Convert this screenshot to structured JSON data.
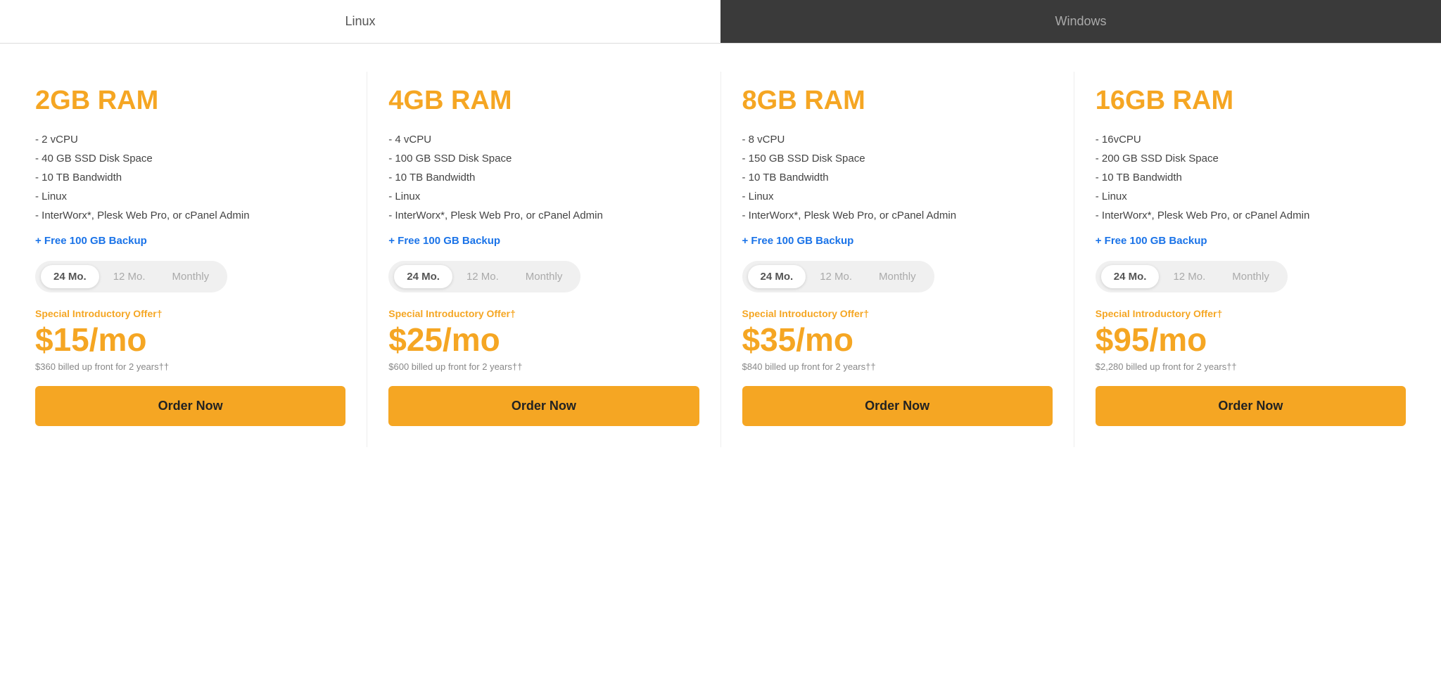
{
  "tabs": [
    {
      "id": "linux",
      "label": "Linux",
      "active": true
    },
    {
      "id": "windows",
      "label": "Windows",
      "active": false
    }
  ],
  "plans": [
    {
      "id": "2gb",
      "title": "2GB RAM",
      "features": [
        "- 2 vCPU",
        "- 40 GB SSD Disk Space",
        "- 10 TB Bandwidth",
        "- Linux",
        "- InterWorx*, Plesk Web Pro, or cPanel Admin"
      ],
      "backup": "+ Free 100 GB Backup",
      "toggle": {
        "options": [
          {
            "label": "24 Mo.",
            "selected": true
          },
          {
            "label": "12 Mo.",
            "selected": false
          },
          {
            "label": "Monthly",
            "selected": false
          }
        ]
      },
      "intro_label": "Special Introductory Offer†",
      "price": "$15/mo",
      "billed": "$360 billed up front for 2 years††",
      "order_label": "Order Now"
    },
    {
      "id": "4gb",
      "title": "4GB RAM",
      "features": [
        "- 4 vCPU",
        "- 100 GB SSD Disk Space",
        "- 10 TB Bandwidth",
        "- Linux",
        "- InterWorx*, Plesk Web Pro, or cPanel Admin"
      ],
      "backup": "+ Free 100 GB Backup",
      "toggle": {
        "options": [
          {
            "label": "24 Mo.",
            "selected": true
          },
          {
            "label": "12 Mo.",
            "selected": false
          },
          {
            "label": "Monthly",
            "selected": false
          }
        ]
      },
      "intro_label": "Special Introductory Offer†",
      "price": "$25/mo",
      "billed": "$600 billed up front for 2 years††",
      "order_label": "Order Now"
    },
    {
      "id": "8gb",
      "title": "8GB RAM",
      "features": [
        "- 8 vCPU",
        "- 150 GB SSD Disk Space",
        "- 10 TB Bandwidth",
        "- Linux",
        "- InterWorx*, Plesk Web Pro, or cPanel Admin"
      ],
      "backup": "+ Free 100 GB Backup",
      "toggle": {
        "options": [
          {
            "label": "24 Mo.",
            "selected": true
          },
          {
            "label": "12 Mo.",
            "selected": false
          },
          {
            "label": "Monthly",
            "selected": false
          }
        ]
      },
      "intro_label": "Special Introductory Offer†",
      "price": "$35/mo",
      "billed": "$840 billed up front for 2 years††",
      "order_label": "Order Now"
    },
    {
      "id": "16gb",
      "title": "16GB RAM",
      "features": [
        "- 16vCPU",
        "- 200 GB SSD Disk Space",
        "- 10 TB Bandwidth",
        "- Linux",
        "- InterWorx*, Plesk Web Pro, or cPanel Admin"
      ],
      "backup": "+ Free 100 GB Backup",
      "toggle": {
        "options": [
          {
            "label": "24 Mo.",
            "selected": true
          },
          {
            "label": "12 Mo.",
            "selected": false
          },
          {
            "label": "Monthly",
            "selected": false
          }
        ]
      },
      "intro_label": "Special Introductory Offer†",
      "price": "$95/mo",
      "billed": "$2,280 billed up front for 2 years††",
      "order_label": "Order Now"
    }
  ]
}
